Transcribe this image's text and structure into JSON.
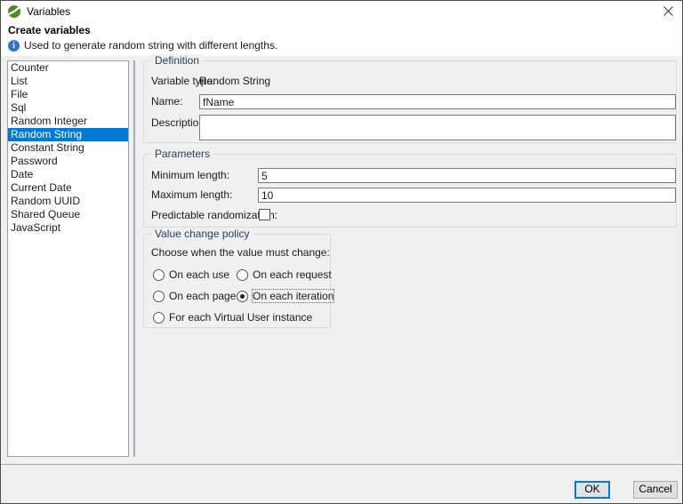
{
  "window": {
    "title": "Variables"
  },
  "header": {
    "title": "Create variables",
    "info_text": "Used to generate random string with different lengths."
  },
  "sidebar": {
    "items": [
      {
        "label": "Counter",
        "selected": false
      },
      {
        "label": "List",
        "selected": false
      },
      {
        "label": "File",
        "selected": false
      },
      {
        "label": "Sql",
        "selected": false
      },
      {
        "label": "Random Integer",
        "selected": false
      },
      {
        "label": "Random String",
        "selected": true
      },
      {
        "label": "Constant String",
        "selected": false
      },
      {
        "label": "Password",
        "selected": false
      },
      {
        "label": "Date",
        "selected": false
      },
      {
        "label": "Current Date",
        "selected": false
      },
      {
        "label": "Random UUID",
        "selected": false
      },
      {
        "label": "Shared Queue",
        "selected": false
      },
      {
        "label": "JavaScript",
        "selected": false
      }
    ]
  },
  "definition": {
    "title": "Definition",
    "variable_type_label": "Variable type:",
    "variable_type_value": "Random String",
    "name_label": "Name:",
    "name_value": "fName",
    "description_label": "Description:",
    "description_value": ""
  },
  "parameters": {
    "title": "Parameters",
    "minimum_label": "Minimum length:",
    "minimum_value": "5",
    "maximum_label": "Maximum length:",
    "maximum_value": "10",
    "predictable_label": "Predictable randomization:",
    "predictable_checked": false
  },
  "value_change_policy": {
    "title": "Value change policy",
    "prompt": "Choose when the value must change:",
    "options": [
      {
        "label": "On each use",
        "selected": false
      },
      {
        "label": "On each request",
        "selected": false
      },
      {
        "label": "On each page",
        "selected": false
      },
      {
        "label": "On each iteration",
        "selected": true
      },
      {
        "label": "For each Virtual User instance",
        "selected": false
      }
    ]
  },
  "buttons": {
    "ok_label": "OK",
    "cancel_label": "Cancel"
  },
  "icons": {
    "app": "neoload-sphere-icon",
    "info": "info-circle-icon",
    "close": "close-x-icon"
  },
  "colors": {
    "selection": "#0078d7",
    "window_bg": "#f0f0f0",
    "header_bg": "#ffffff",
    "ok_focus_border": "#0078d7"
  }
}
